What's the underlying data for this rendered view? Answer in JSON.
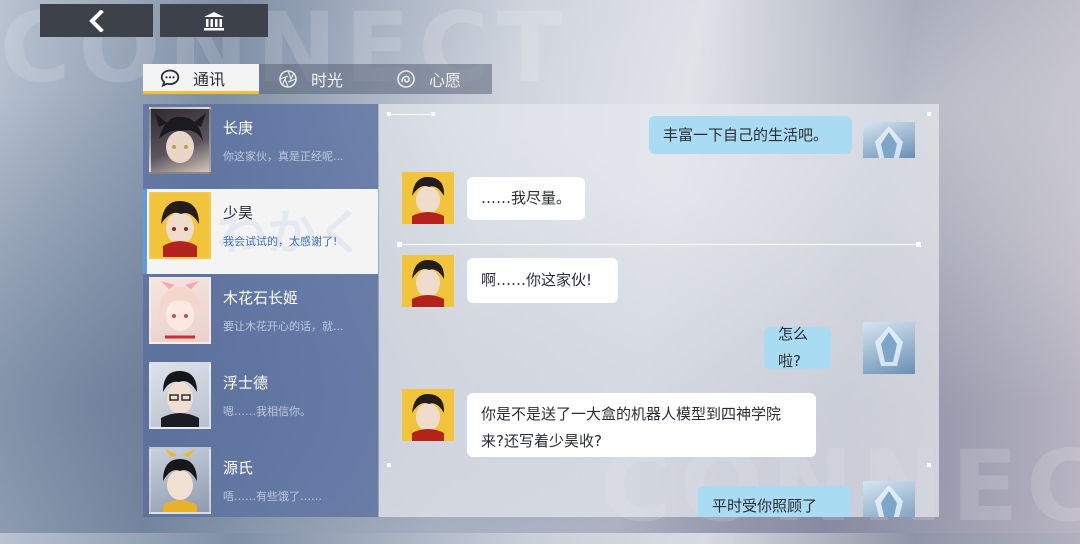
{
  "watermark": {
    "top": "CONNECT",
    "bottom": "CONNECT"
  },
  "topbar": {
    "back_icon": "chevron-left-icon",
    "home_icon": "bank-icon"
  },
  "tabs": [
    {
      "label": "通讯",
      "icon": "chat-bubble-icon",
      "active": true
    },
    {
      "label": "时光",
      "icon": "shutter-icon",
      "active": false
    },
    {
      "label": "心愿",
      "icon": "wish-swirl-icon",
      "active": false
    }
  ],
  "contacts": [
    {
      "name": "长庚",
      "preview": "你这家伙，真是正经呢...",
      "selected": false
    },
    {
      "name": "少昊",
      "preview": "我会试试的，太感谢了!",
      "selected": true,
      "deco": "わかく"
    },
    {
      "name": "木花石长姬",
      "preview": "要让木花开心的话，就...",
      "selected": false
    },
    {
      "name": "浮士德",
      "preview": "嗯……我相信你。",
      "selected": false
    },
    {
      "name": "源氏",
      "preview": "唔……有些饿了……",
      "selected": false
    }
  ],
  "messages": [
    {
      "side": "right",
      "text": "丰富一下自己的生活吧。"
    },
    {
      "side": "left",
      "text": "……我尽量。"
    },
    {
      "side": "left",
      "text": "啊……你这家伙!"
    },
    {
      "side": "right",
      "text": "怎么啦?"
    },
    {
      "side": "left",
      "line1": "你是不是送了一大盒的机器人模型到四神学院",
      "line2": "来?还写着少昊收?"
    },
    {
      "side": "right",
      "text": "平时受你照顾了"
    }
  ],
  "colors": {
    "accent_tab": "#f0c23a",
    "selected_border": "#5e9ce0",
    "bubble_right": "#a9dcf2",
    "bubble_left": "#ffffff"
  }
}
